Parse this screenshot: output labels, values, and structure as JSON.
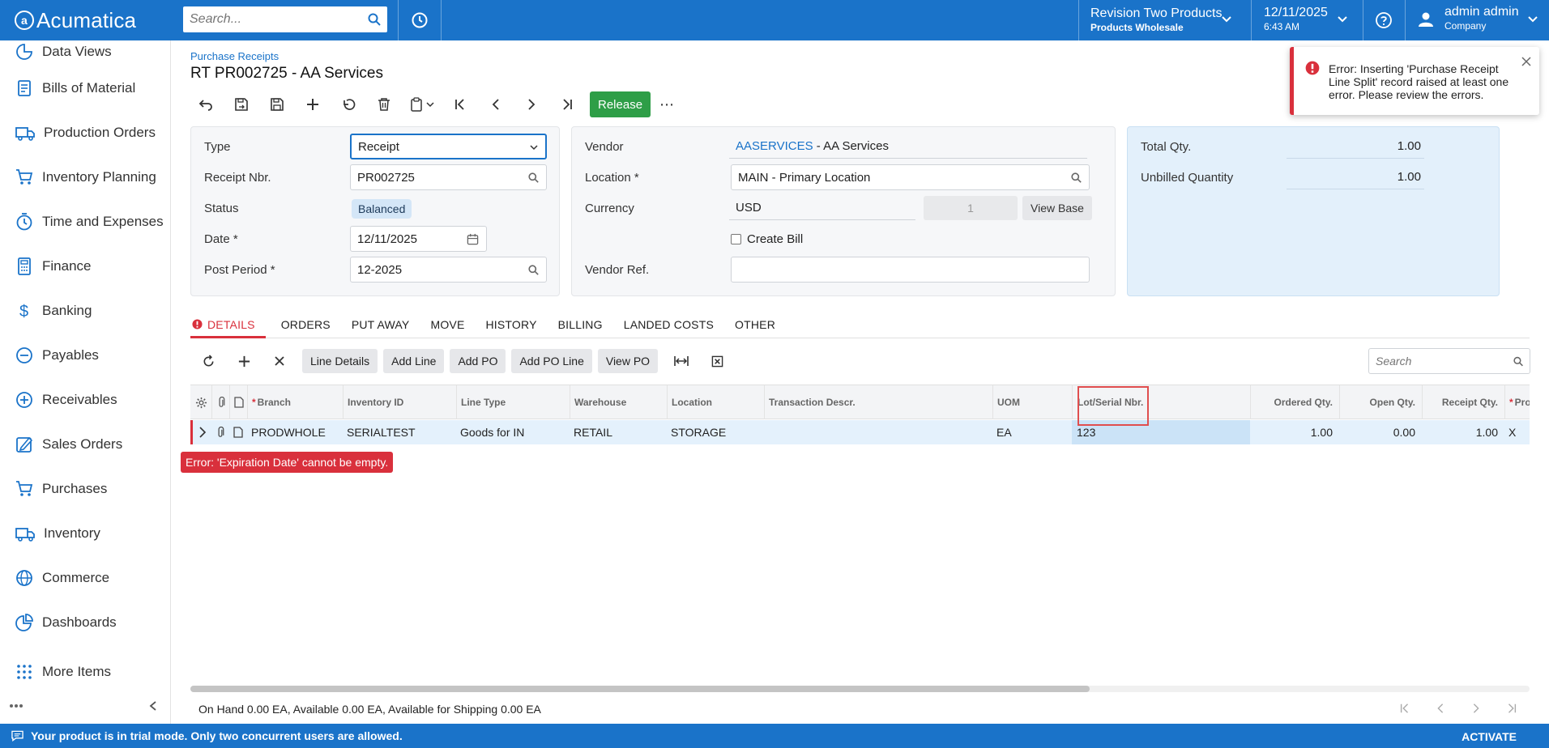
{
  "app": {
    "name": "Acumatica"
  },
  "topbar": {
    "search_placeholder": "Search...",
    "tenant_name": "Revision Two Products",
    "tenant_sub": "Products Wholesale",
    "date": "12/11/2025",
    "time": "6:43 AM",
    "user_name": "admin admin",
    "user_company": "Company"
  },
  "sidebar": {
    "items": [
      {
        "label": "Data Views",
        "icon": "data-views-icon"
      },
      {
        "label": "Bills of Material",
        "icon": "bills-of-material-icon"
      },
      {
        "label": "Production Orders",
        "icon": "production-orders-icon"
      },
      {
        "label": "Inventory Planning",
        "icon": "inventory-planning-icon"
      },
      {
        "label": "Time and Expenses",
        "icon": "time-expenses-icon"
      },
      {
        "label": "Finance",
        "icon": "finance-icon"
      },
      {
        "label": "Banking",
        "icon": "banking-icon"
      },
      {
        "label": "Payables",
        "icon": "payables-icon"
      },
      {
        "label": "Receivables",
        "icon": "receivables-icon"
      },
      {
        "label": "Sales Orders",
        "icon": "sales-orders-icon"
      },
      {
        "label": "Purchases",
        "icon": "purchases-icon"
      },
      {
        "label": "Inventory",
        "icon": "inventory-icon"
      },
      {
        "label": "Commerce",
        "icon": "commerce-icon"
      },
      {
        "label": "Dashboards",
        "icon": "dashboards-icon"
      },
      {
        "label": "More Items",
        "icon": "more-items-icon"
      }
    ]
  },
  "page": {
    "breadcrumb": "Purchase Receipts",
    "title": "RT PR002725 - AA Services"
  },
  "toolbar": {
    "release_label": "Release"
  },
  "form": {
    "type_label": "Type",
    "type_value": "Receipt",
    "receipt_nbr_label": "Receipt Nbr.",
    "receipt_nbr_value": "PR002725",
    "status_label": "Status",
    "status_value": "Balanced",
    "date_label": "Date",
    "date_value": "12/11/2025",
    "post_period_label": "Post Period",
    "post_period_value": "12-2025",
    "vendor_label": "Vendor",
    "vendor_code": "AASERVICES",
    "vendor_name": " - AA Services",
    "location_label": "Location",
    "location_value": "MAIN - Primary Location",
    "currency_label": "Currency",
    "currency_value": "USD",
    "currency_rate": "1",
    "view_base_label": "View Base",
    "create_bill_label": "Create Bill",
    "vendor_ref_label": "Vendor Ref.",
    "vendor_ref_value": "",
    "total_qty_label": "Total Qty.",
    "total_qty_value": "1.00",
    "unbilled_qty_label": "Unbilled Quantity",
    "unbilled_qty_value": "1.00"
  },
  "tabs": [
    "DETAILS",
    "ORDERS",
    "PUT AWAY",
    "MOVE",
    "HISTORY",
    "BILLING",
    "LANDED COSTS",
    "OTHER"
  ],
  "grid_toolbar": {
    "buttons": [
      "Line Details",
      "Add Line",
      "Add PO",
      "Add PO Line",
      "View PO"
    ],
    "search_placeholder": "Search"
  },
  "grid": {
    "columns": [
      "Branch",
      "Inventory ID",
      "Line Type",
      "Warehouse",
      "Location",
      "Transaction Descr.",
      "UOM",
      "Lot/Serial Nbr.",
      "Ordered Qty.",
      "Open Qty.",
      "Receipt Qty.",
      "Proje"
    ],
    "row": {
      "branch": "PRODWHOLE",
      "inventory_id": "SERIALTEST",
      "line_type": "Goods for IN",
      "warehouse": "RETAIL",
      "location": "STORAGE",
      "transaction_descr": "",
      "uom": "EA",
      "lot_serial": "123",
      "ordered_qty": "1.00",
      "open_qty": "0.00",
      "receipt_qty": "1.00",
      "project": "X"
    },
    "row_error": "Error: 'Expiration Date' cannot be empty."
  },
  "footer": {
    "availability": "On Hand 0.00 EA, Available 0.00 EA, Available for Shipping 0.00 EA"
  },
  "toast": {
    "message": "Error: Inserting 'Purchase Receipt Line Split' record raised at least one error. Please review the errors."
  },
  "banner": {
    "message": "Your product is in trial mode. Only two concurrent users are allowed.",
    "activate": "ACTIVATE"
  },
  "colors": {
    "brand": "#1a73c9",
    "release": "#2e9e47",
    "error": "#d9303c"
  }
}
